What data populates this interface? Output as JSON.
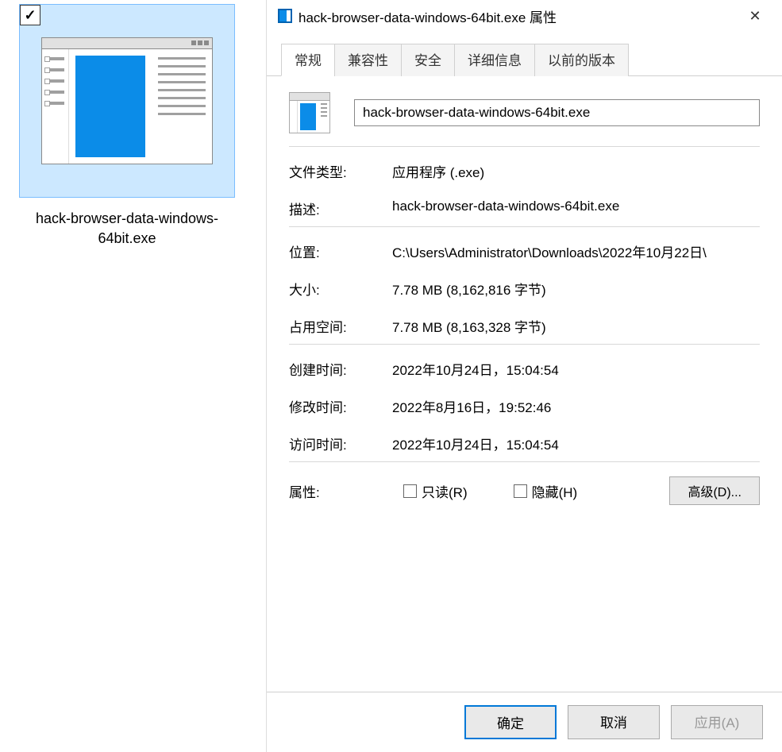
{
  "explorer": {
    "file_name": "hack-browser-data-windows-64bit.exe"
  },
  "dialog": {
    "title": "hack-browser-data-windows-64bit.exe 属性",
    "tabs": {
      "general": "常规",
      "compat": "兼容性",
      "security": "安全",
      "details": "详细信息",
      "previous": "以前的版本"
    },
    "filename": "hack-browser-data-windows-64bit.exe",
    "labels": {
      "filetype": "文件类型:",
      "description": "描述:",
      "location": "位置:",
      "size": "大小:",
      "size_on_disk": "占用空间:",
      "created": "创建时间:",
      "modified": "修改时间:",
      "accessed": "访问时间:",
      "attributes": "属性:",
      "readonly": "只读(R)",
      "hidden": "隐藏(H)",
      "advanced": "高级(D)..."
    },
    "values": {
      "filetype": "应用程序 (.exe)",
      "description": "hack-browser-data-windows-64bit.exe",
      "location": "C:\\Users\\Administrator\\Downloads\\2022年10月22日\\",
      "size": "7.78 MB (8,162,816 字节)",
      "size_on_disk": "7.78 MB (8,163,328 字节)",
      "created": "2022年10月24日，15:04:54",
      "modified": "2022年8月16日，19:52:46",
      "accessed": "2022年10月24日，15:04:54"
    },
    "buttons": {
      "ok": "确定",
      "cancel": "取消",
      "apply": "应用(A)"
    }
  }
}
